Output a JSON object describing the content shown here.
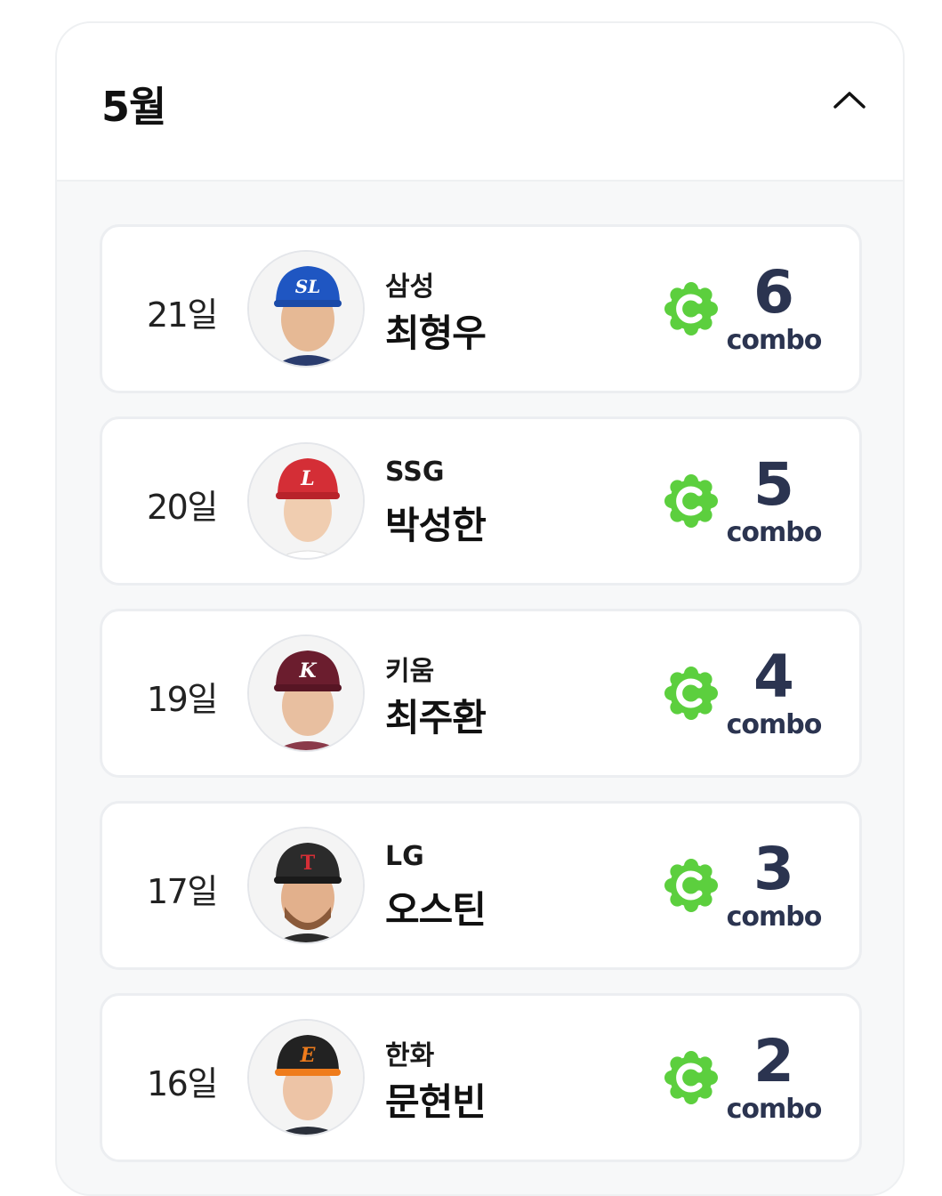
{
  "month": {
    "title": "5월"
  },
  "colors": {
    "accent": "#5ccf3e",
    "combo_text": "#2b3450"
  },
  "entries": [
    {
      "day": "21일",
      "team": "삼성",
      "player": "최형우",
      "combo": "6",
      "combo_label": "combo",
      "cap_color": "#1f56c2",
      "cap_logo": "SL"
    },
    {
      "day": "20일",
      "team": "SSG",
      "player": "박성한",
      "combo": "5",
      "combo_label": "combo",
      "cap_color": "#d42e36",
      "cap_logo": "L"
    },
    {
      "day": "19일",
      "team": "키움",
      "player": "최주환",
      "combo": "4",
      "combo_label": "combo",
      "cap_color": "#6b1d2e",
      "cap_logo": "K"
    },
    {
      "day": "17일",
      "team": "LG",
      "player": "오스틴",
      "combo": "3",
      "combo_label": "combo",
      "cap_color": "#2b2b2b",
      "cap_logo": "T"
    },
    {
      "day": "16일",
      "team": "한화",
      "player": "문현빈",
      "combo": "2",
      "combo_label": "combo",
      "cap_color": "#222222",
      "cap_logo": "E"
    }
  ]
}
